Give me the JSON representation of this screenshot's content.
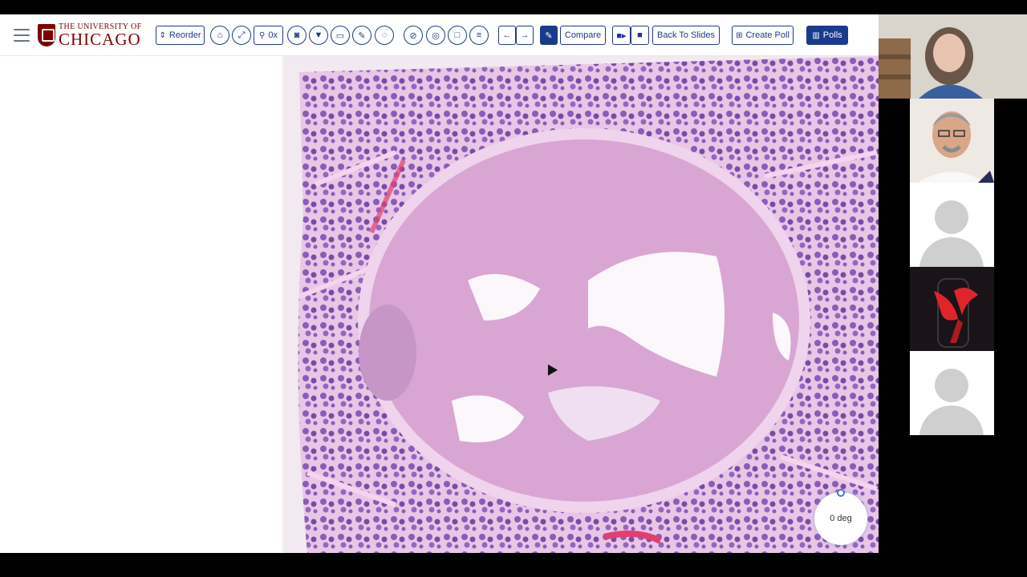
{
  "app": {
    "logo_top": "THE UNIVERSITY OF",
    "logo_main": "CHICAGO"
  },
  "toolbar": {
    "reorder_label": "Reorder",
    "zoom_label": "0x",
    "compare_label": "Compare",
    "back_label": "Back To Slides",
    "create_poll_label": "Create Poll",
    "polls_label": "Polls",
    "icons": [
      "menu-icon",
      "home-icon",
      "expand-icon",
      "zoom-icon",
      "camera-icon",
      "filter-icon",
      "monitor-icon",
      "pencil-icon",
      "lasso-icon",
      "measure-icon",
      "circle-target-icon",
      "square-icon",
      "list-icon",
      "arrow-left-icon",
      "arrow-right-icon",
      "paperclip-icon",
      "video-icon",
      "stop-icon",
      "plus-square-icon",
      "bar-chart-icon"
    ]
  },
  "viewer": {
    "rotation_label": "0 deg"
  },
  "colors": {
    "brand": "#800000",
    "accent": "#1a3b8c",
    "tissue": "#d9a6d4",
    "stain_dark": "#7a4aa8",
    "stain_red": "#e04070"
  }
}
